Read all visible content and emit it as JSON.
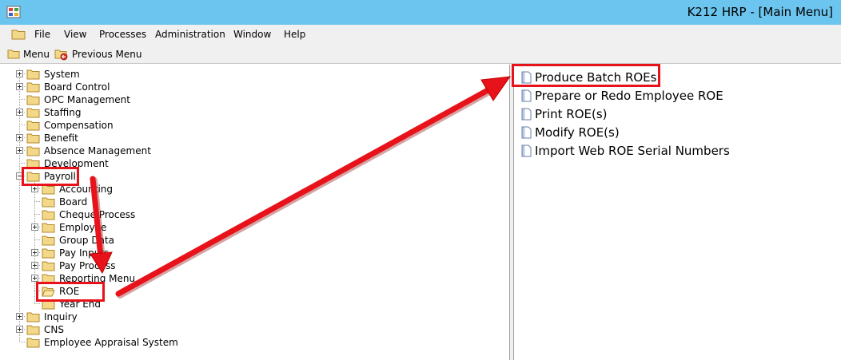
{
  "window": {
    "title": "K212 HRP - [Main Menu]",
    "app_icon": "hrp-app-icon"
  },
  "menubar": {
    "icon": "folder-icon",
    "items": [
      "File",
      "View",
      "Processes",
      "Administration",
      "Window",
      "Help"
    ]
  },
  "toolbar": {
    "menu_label": "Menu",
    "previous_label": "Previous Menu"
  },
  "tree": {
    "system": "System",
    "board_control": "Board Control",
    "opc_management": "OPC Management",
    "staffing": "Staffing",
    "compensation": "Compensation",
    "benefit": "Benefit",
    "absence_management": "Absence Management",
    "development": "Development",
    "payroll": "Payroll",
    "accounting": "Accounting",
    "board": "Board",
    "cheque_process": "Cheque Process",
    "employee": "Employee",
    "group_data": "Group Data",
    "pay_inputs": "Pay Inputs",
    "pay_process": "Pay Process",
    "reporting_menu": "Reporting Menu",
    "roe": "ROE",
    "year_end": "Year End",
    "inquiry": "Inquiry",
    "cns": "CNS",
    "employee_appraisal": "Employee Appraisal System"
  },
  "roe_menu": {
    "items": [
      "Produce Batch ROEs",
      "Prepare or Redo Employee ROE",
      "Print ROE(s)",
      "Modify ROE(s)",
      "Import Web ROE Serial Numbers"
    ]
  },
  "colors": {
    "titlebar": "#6cc5ee",
    "chrome": "#f0f0f0",
    "annotation_red": "#e8121a",
    "folder_fill": "#f4d88a",
    "folder_edge": "#b08a2a"
  }
}
